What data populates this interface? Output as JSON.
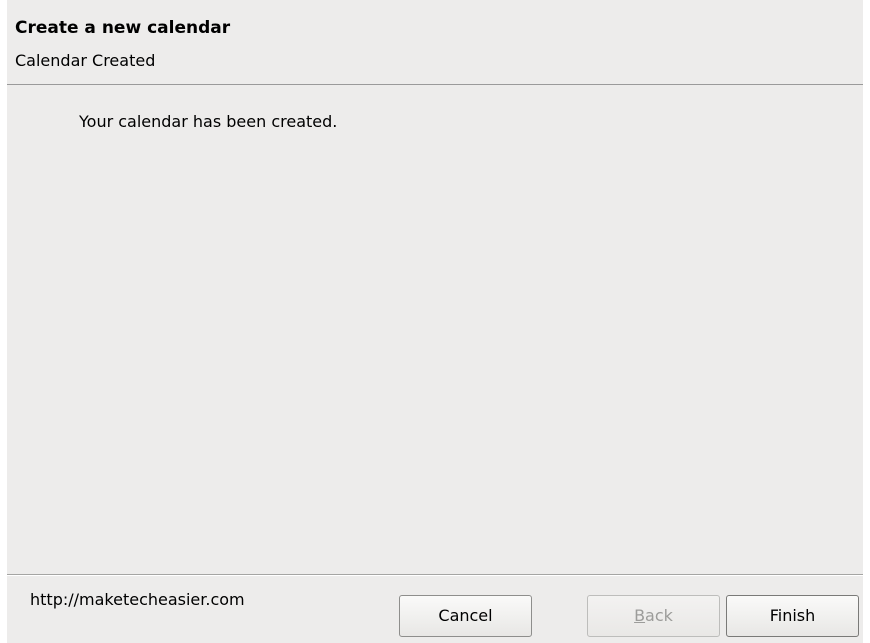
{
  "dialog": {
    "title": "Create a new calendar",
    "subtitle": "Calendar Created",
    "message": "Your calendar has been created.",
    "footer_link": "http://maketecheasier.com"
  },
  "buttons": {
    "cancel_label": "Cancel",
    "back_mnemonic": "B",
    "back_rest": "ack",
    "finish_label": "Finish"
  },
  "colors": {
    "dialog_bg": "#edeceb",
    "separator": "#9a9a9a",
    "disabled_text": "#9c9c9a"
  }
}
